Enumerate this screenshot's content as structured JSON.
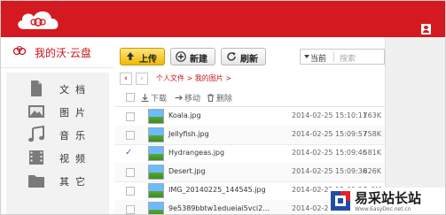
{
  "header": {
    "brand_color": "#d51920"
  },
  "sidebar": {
    "brand_text": "我的沃·云盘",
    "items": [
      {
        "label": "文档",
        "icon": "document-icon"
      },
      {
        "label": "图片",
        "icon": "picture-icon"
      },
      {
        "label": "音乐",
        "icon": "music-icon"
      },
      {
        "label": "视频",
        "icon": "video-icon"
      },
      {
        "label": "其它",
        "icon": "folder-icon"
      }
    ]
  },
  "toolbar": {
    "upload_label": "上传",
    "new_label": "新建",
    "refresh_label": "刷新",
    "sort_value": "当前",
    "search_placeholder": "搜索"
  },
  "breadcrumb": {
    "path": "个人文件 > 我的图片 >"
  },
  "actions": {
    "download_label": "下载",
    "move_label": "移动",
    "delete_label": "删除"
  },
  "files": [
    {
      "name": "Koala.jpg",
      "date": "2014-02-25 15:10:11",
      "size": "763K",
      "checked": false
    },
    {
      "name": "Jellyfish.jpg",
      "date": "2014-02-25 15:09:57",
      "size": "758K",
      "checked": false
    },
    {
      "name": "Hydrangeas.jpg",
      "date": "2014-02-25 15:09:46",
      "size": "581K",
      "checked": true
    },
    {
      "name": "Desert.jpg",
      "date": "2014-02-25 15:09:36",
      "size": "826K",
      "checked": false
    },
    {
      "name": "IMG_20140225_144545.jpg",
      "date": "2014-02-25 15:09:26",
      "size": "1.6M",
      "checked": false
    },
    {
      "name": "9e5389bbtw1edueiai5vci2...",
      "date": "2014-02-25 15:08:50",
      "size": "",
      "checked": false
    }
  ],
  "watermark": {
    "title": "易采站长站",
    "url": "Www.EasyDoc.net.cn"
  }
}
